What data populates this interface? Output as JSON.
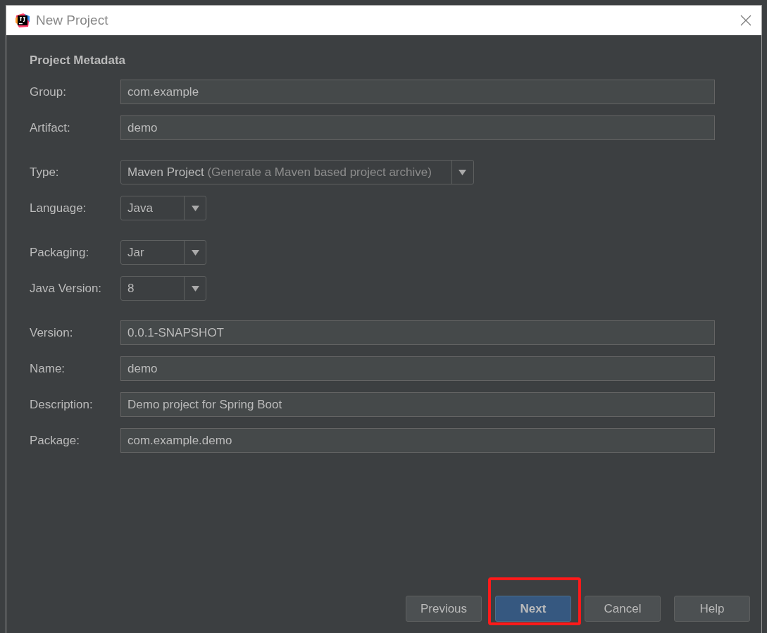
{
  "window": {
    "title": "New Project"
  },
  "section_title": "Project Metadata",
  "field_groups": [
    {
      "fields": [
        {
          "kind": "text",
          "label": "Group:",
          "value": "com.example"
        },
        {
          "kind": "text",
          "label": "Artifact:",
          "value": "demo"
        }
      ]
    },
    {
      "fields": [
        {
          "kind": "dropdown",
          "label": "Type:",
          "value": "Maven Project",
          "hint": "(Generate a Maven based project archive)"
        },
        {
          "kind": "dropdown",
          "label": "Language:",
          "value": "Java"
        }
      ]
    },
    {
      "fields": [
        {
          "kind": "dropdown",
          "label": "Packaging:",
          "value": "Jar"
        },
        {
          "kind": "dropdown",
          "label": "Java Version:",
          "value": "8"
        }
      ]
    },
    {
      "fields": [
        {
          "kind": "text",
          "label": "Version:",
          "value": "0.0.1-SNAPSHOT"
        },
        {
          "kind": "text",
          "label": "Name:",
          "value": "demo"
        },
        {
          "kind": "text",
          "label": "Description:",
          "value": "Demo project for Spring Boot"
        },
        {
          "kind": "text",
          "label": "Package:",
          "value": "com.example.demo"
        }
      ]
    }
  ],
  "buttons": [
    {
      "label": "Previous",
      "default": false,
      "highlighted": false
    },
    {
      "label": "Next",
      "default": true,
      "highlighted": true
    },
    {
      "label": "Cancel",
      "default": false,
      "highlighted": false
    },
    {
      "label": "Help",
      "default": false,
      "highlighted": false
    }
  ]
}
